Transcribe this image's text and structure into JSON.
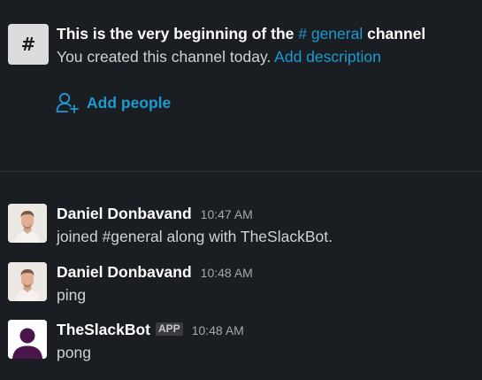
{
  "intro": {
    "hash_glyph": "#",
    "title_prefix": "This is the very beginning of the",
    "channel_name": "# general",
    "title_suffix": "channel",
    "subtitle": "You created this channel today.",
    "add_description": "Add description",
    "add_people_icon": "add-person-icon",
    "add_people_label": "Add people"
  },
  "messages": [
    {
      "sender": "Daniel Donbavand",
      "time": "10:47 AM",
      "text": "joined #general along with TheSlackBot."
    },
    {
      "sender": "Daniel Donbavand",
      "time": "10:48 AM",
      "text": "ping"
    },
    {
      "sender": "TheSlackBot",
      "badge": "APP",
      "time": "10:48 AM",
      "text": "pong"
    }
  ],
  "colors": {
    "background": "#1a1d21",
    "link": "#1d9bd1",
    "bot_avatar": "#4a154b"
  }
}
